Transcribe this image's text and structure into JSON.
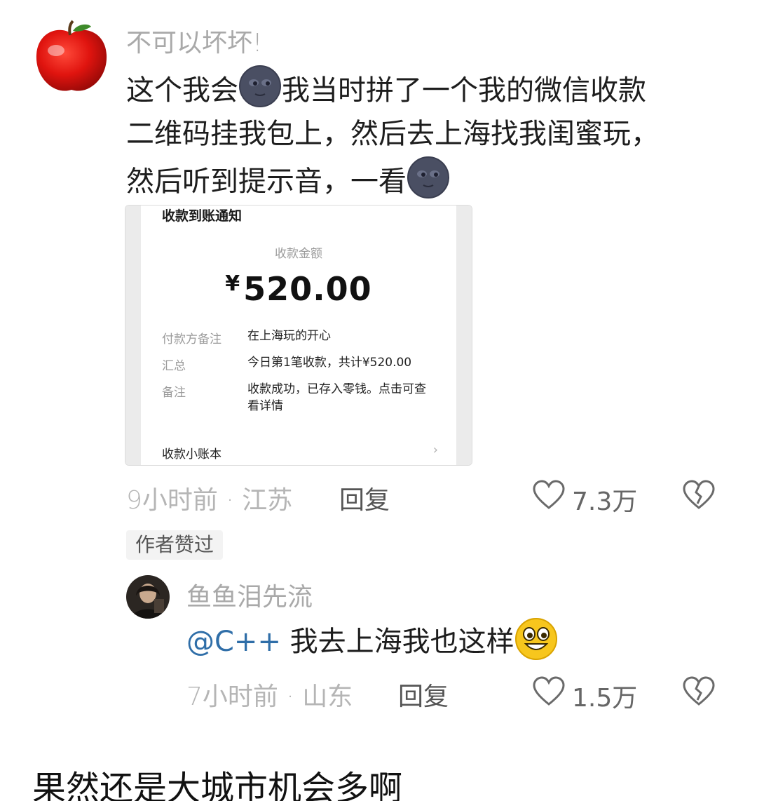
{
  "comment": {
    "username": "不可以坏坏!",
    "text_part1": "这个我会",
    "text_part2": "我当时拼了一个我的微信收款",
    "text_line2": "二维码挂我包上，然后去上海找我闺蜜玩，",
    "text_line3_a": "然后听到提示音，一看",
    "emoji_icon": "new-moon-face-icon",
    "time": "9小时前 · 江苏",
    "reply_label": "回复",
    "likes": "7.3万",
    "author_liked_badge": "作者赞过"
  },
  "receipt": {
    "title": "收款到账通知",
    "amount_label": "收款金额",
    "currency": "¥",
    "amount": "520.00",
    "rows": [
      {
        "label": "付款方备注",
        "value": "在上海玩的开心"
      },
      {
        "label": "汇总",
        "value": "今日第1笔收款，共计¥520.00"
      },
      {
        "label": "备注",
        "value": "收款成功，已存入零钱。点击可查看详情"
      }
    ],
    "footer": "收款小账本",
    "chevron": "›"
  },
  "reply": {
    "username": "鱼鱼泪先流",
    "mention": "@C++",
    "text": " 我去上海我也这样",
    "emoji_icon": "grinning-face-icon",
    "time": "7小时前 · 山东",
    "reply_label": "回复",
    "likes": "1.5万"
  },
  "caption": "果然还是大城市机会多啊",
  "colors": {
    "mention": "#2f6ea8",
    "muted": "#a9a9a9"
  }
}
